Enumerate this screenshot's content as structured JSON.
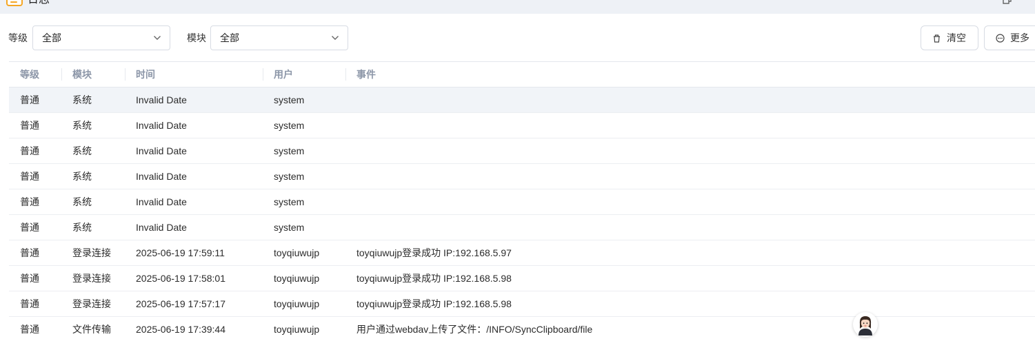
{
  "window": {
    "title": "日志",
    "icon": "log-app-icon"
  },
  "filters": {
    "level_label": "等级",
    "level_value": "全部",
    "module_label": "模块",
    "module_value": "全部"
  },
  "toolbar": {
    "clear_label": "清空",
    "clear_icon": "trash-icon",
    "more_label": "更多",
    "more_icon": "more-circle-icon"
  },
  "table": {
    "columns": [
      "等级",
      "模块",
      "时间",
      "用户",
      "事件"
    ],
    "rows": [
      {
        "level": "普通",
        "module": "系统",
        "time": "Invalid Date",
        "user": "system",
        "event": ""
      },
      {
        "level": "普通",
        "module": "系统",
        "time": "Invalid Date",
        "user": "system",
        "event": ""
      },
      {
        "level": "普通",
        "module": "系统",
        "time": "Invalid Date",
        "user": "system",
        "event": ""
      },
      {
        "level": "普通",
        "module": "系统",
        "time": "Invalid Date",
        "user": "system",
        "event": ""
      },
      {
        "level": "普通",
        "module": "系统",
        "time": "Invalid Date",
        "user": "system",
        "event": ""
      },
      {
        "level": "普通",
        "module": "系统",
        "time": "Invalid Date",
        "user": "system",
        "event": ""
      },
      {
        "level": "普通",
        "module": "登录连接",
        "time": "2025-06-19 17:59:11",
        "user": "toyqiuwujp",
        "event": "toyqiuwujp登录成功 IP:192.168.5.97"
      },
      {
        "level": "普通",
        "module": "登录连接",
        "time": "2025-06-19 17:58:01",
        "user": "toyqiuwujp",
        "event": "toyqiuwujp登录成功 IP:192.168.5.98"
      },
      {
        "level": "普通",
        "module": "登录连接",
        "time": "2025-06-19 17:57:17",
        "user": "toyqiuwujp",
        "event": "toyqiuwujp登录成功 IP:192.168.5.98"
      },
      {
        "level": "普通",
        "module": "文件传输",
        "time": "2025-06-19 17:39:44",
        "user": "toyqiuwujp",
        "event": "用户通过webdav上传了文件：/INFO/SyncClipboard/file"
      }
    ]
  },
  "assistant": {
    "icon": "assistant-avatar-icon"
  }
}
